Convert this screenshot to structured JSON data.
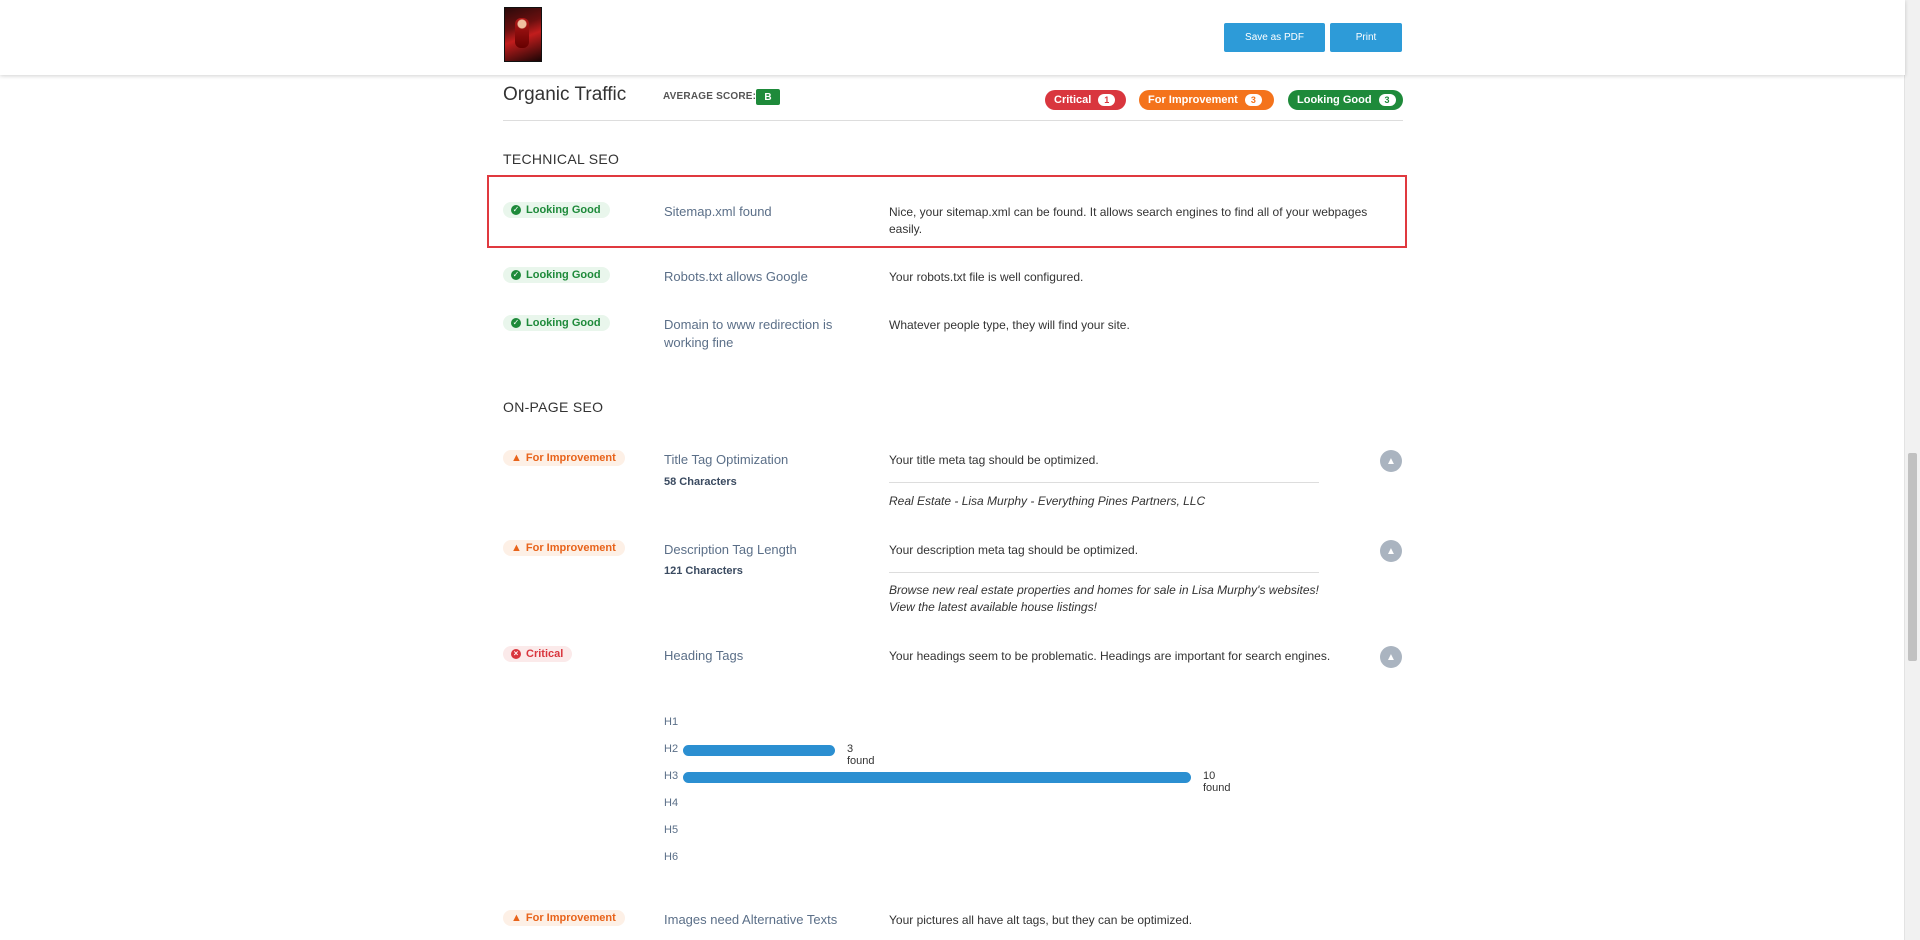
{
  "header": {
    "logo_icon": "profile-thumbnail-icon",
    "save_pdf_label": "Save as PDF",
    "print_label": "Print"
  },
  "summary": {
    "title": "Organic Traffic",
    "average_label": "AVERAGE SCORE:",
    "average_score": "B",
    "critical_label": "Critical",
    "critical_count": "1",
    "improvement_label": "For Improvement",
    "improvement_count": "3",
    "good_label": "Looking Good",
    "good_count": "3",
    "colors": {
      "critical": "#d9363e",
      "improvement": "#f4731c",
      "good": "#1e8a3a",
      "accent": "#2d9bd8"
    }
  },
  "technical": {
    "heading": "TECHNICAL SEO",
    "items": [
      {
        "status": "Looking Good",
        "name": "Sitemap.xml found",
        "desc": "Nice, your sitemap.xml can be found. It allows search engines to find all of your webpages easily."
      },
      {
        "status": "Looking Good",
        "name": "Robots.txt allows Google",
        "desc": "Your robots.txt file is well configured."
      },
      {
        "status": "Looking Good",
        "name": "Domain to www redirection is working fine",
        "desc": "Whatever people type, they will find your site."
      }
    ]
  },
  "onpage": {
    "heading": "ON-PAGE SEO",
    "items": [
      {
        "status": "For Improvement",
        "name": "Title Tag Optimization",
        "count": "58 Characters",
        "desc": "Your title meta tag should be optimized.",
        "detail": "Real Estate - Lisa Murphy - Everything Pines Partners, LLC"
      },
      {
        "status": "For Improvement",
        "name": "Description Tag Length",
        "count": "121 Characters",
        "desc": "Your description meta tag should be optimized.",
        "detail": "Browse new real estate properties and homes for sale in Lisa Murphy's websites! View the latest available house listings!"
      },
      {
        "status": "Critical",
        "name": "Heading Tags",
        "desc": "Your headings seem to be problematic. Headings are important for search engines."
      },
      {
        "status": "For Improvement",
        "name": "Images need Alternative Texts",
        "desc": "Your pictures all have alt tags, but they can be optimized."
      }
    ]
  },
  "headings": {
    "levels": [
      "H1",
      "H2",
      "H3",
      "H4",
      "H5",
      "H6"
    ],
    "counts": [
      0,
      3,
      10,
      0,
      0,
      0
    ],
    "labels": [
      "",
      "3 found",
      "10 found",
      "",
      "",
      ""
    ],
    "max": 10
  }
}
